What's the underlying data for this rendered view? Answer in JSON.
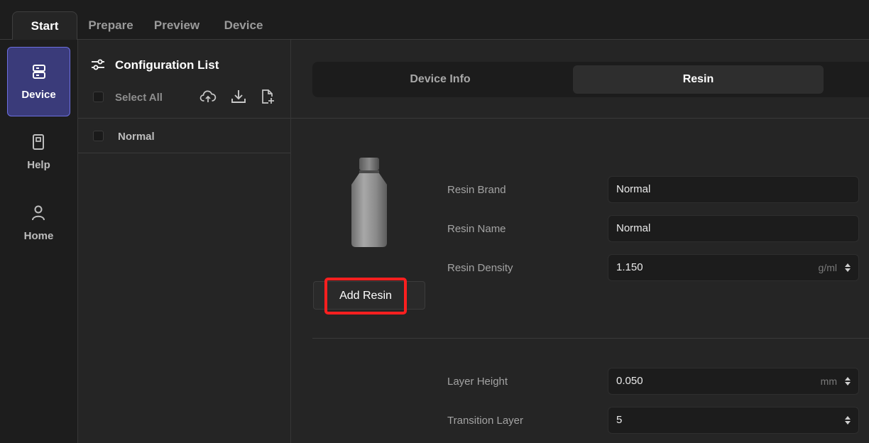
{
  "tabs": [
    {
      "label": "Start",
      "active": true
    },
    {
      "label": "Prepare",
      "active": false
    },
    {
      "label": "Preview",
      "active": false
    },
    {
      "label": "Device",
      "active": false
    }
  ],
  "leftnav": {
    "items": [
      {
        "label": "Device",
        "icon": "device-icon",
        "active": true
      },
      {
        "label": "Help",
        "icon": "book-icon",
        "active": false
      },
      {
        "label": "Home",
        "icon": "person-icon",
        "active": false
      }
    ]
  },
  "config_list": {
    "title": "Configuration List",
    "title_icon": "sliders-icon",
    "select_all_label": "Select All",
    "tools": [
      "cloud-upload-icon",
      "download-icon",
      "new-file-icon"
    ],
    "items": [
      {
        "label": "Normal",
        "checked": false
      }
    ]
  },
  "main": {
    "segments": [
      {
        "label": "Device Info",
        "active": false
      },
      {
        "label": "Resin",
        "active": true
      }
    ],
    "resin_image": "resin-bottle-image",
    "add_resin_label": "Add Resin",
    "fields": [
      {
        "label": "Resin Brand",
        "value": "Normal",
        "unit": ""
      },
      {
        "label": "Resin Name",
        "value": "Normal",
        "unit": ""
      },
      {
        "label": "Resin Density",
        "value": "1.150",
        "unit": "g/ml"
      },
      {
        "label": "Layer Height",
        "value": "0.050",
        "unit": "mm"
      },
      {
        "label": "Transition Layer",
        "value": "5",
        "unit": ""
      }
    ]
  },
  "colors": {
    "accent": "#6c6fe0",
    "nav_active_bg": "#3a3b7a",
    "highlight": "#ff1f1f",
    "background": "#252525"
  }
}
